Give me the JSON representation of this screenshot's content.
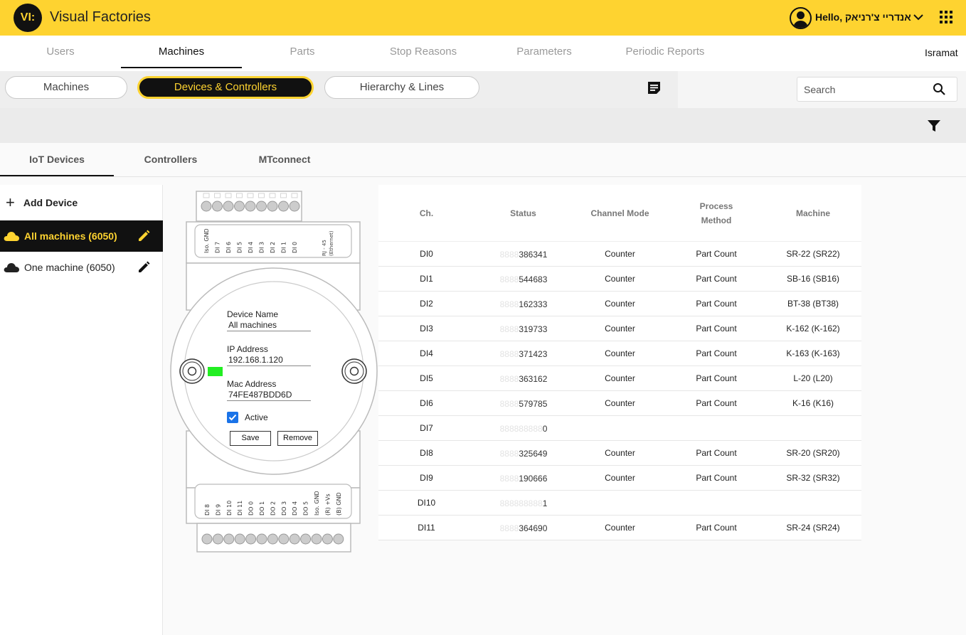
{
  "header": {
    "logo_text": "VI:",
    "brand": "Visual Factories",
    "greeting": "Hello, אנדריי צ'רניאק"
  },
  "main_nav": {
    "tabs": [
      {
        "label": "Users",
        "active": false
      },
      {
        "label": "Machines",
        "active": true
      },
      {
        "label": "Parts",
        "active": false
      },
      {
        "label": "Stop Reasons",
        "active": false
      },
      {
        "label": "Parameters",
        "active": false
      },
      {
        "label": "Periodic Reports",
        "active": false
      }
    ],
    "company": "Isramat"
  },
  "sub_nav": {
    "pills": [
      {
        "label": "Machines",
        "active": false
      },
      {
        "label": "Devices & Controllers",
        "active": true
      },
      {
        "label": "Hierarchy & Lines",
        "active": false
      }
    ],
    "search_placeholder": "Search"
  },
  "device_tabs": [
    {
      "label": "IoT Devices",
      "active": true
    },
    {
      "label": "Controllers",
      "active": false
    },
    {
      "label": "MTconnect",
      "active": false
    }
  ],
  "sidebar": {
    "add_label": "Add Device",
    "devices": [
      {
        "label": "All machines (6050)",
        "active": true
      },
      {
        "label": "One machine (6050)",
        "active": false
      }
    ]
  },
  "device": {
    "top_pins": [
      "Iso. GND",
      "DI 7",
      "DI 6",
      "DI 5",
      "DI 4",
      "DI 3",
      "DI 2",
      "DI 1",
      "DI 0"
    ],
    "ethernet_label": "RJ - 45",
    "ethernet_sub": "(Ethernet)",
    "bottom_pins": [
      "DI 8",
      "DI 9",
      "DI 10",
      "DI 11",
      "DO 0",
      "DO 1",
      "DO 2",
      "DO 3",
      "DO 4",
      "DO 5",
      "Iso. GND",
      "(R) +Vs",
      "(B) GND"
    ],
    "name_label": "Device Name",
    "name_value": "All machines",
    "ip_label": "IP Address",
    "ip_value": "192.168.1.120",
    "mac_label": "Mac Address",
    "mac_value": "74FE487BDD6D",
    "active_label": "Active",
    "active_checked": true,
    "save_label": "Save",
    "remove_label": "Remove",
    "status_color": "#22ee22"
  },
  "table": {
    "headers": {
      "ch": "Ch.",
      "status": "Status",
      "mode": "Channel Mode",
      "process_1": "Process",
      "process_2": "Method",
      "machine": "Machine"
    },
    "rows": [
      {
        "ch": "DI0",
        "ghost": "8888",
        "val": "386341",
        "mode": "Counter",
        "method": "Part Count",
        "machine": "SR-22 (SR22)"
      },
      {
        "ch": "DI1",
        "ghost": "8888",
        "val": "544683",
        "mode": "Counter",
        "method": "Part Count",
        "machine": "SB-16 (SB16)"
      },
      {
        "ch": "DI2",
        "ghost": "8888",
        "val": "162333",
        "mode": "Counter",
        "method": "Part Count",
        "machine": "BT-38 (BT38)"
      },
      {
        "ch": "DI3",
        "ghost": "8888",
        "val": "319733",
        "mode": "Counter",
        "method": "Part Count",
        "machine": "K-162 (K-162)"
      },
      {
        "ch": "DI4",
        "ghost": "8888",
        "val": "371423",
        "mode": "Counter",
        "method": "Part Count",
        "machine": "K-163 (K-163)"
      },
      {
        "ch": "DI5",
        "ghost": "8888",
        "val": "363162",
        "mode": "Counter",
        "method": "Part Count",
        "machine": "L-20 (L20)"
      },
      {
        "ch": "DI6",
        "ghost": "8888",
        "val": "579785",
        "mode": "Counter",
        "method": "Part Count",
        "machine": "K-16 (K16)"
      },
      {
        "ch": "DI7",
        "ghost": "888888888",
        "val": "0",
        "mode": "",
        "method": "",
        "machine": ""
      },
      {
        "ch": "DI8",
        "ghost": "8888",
        "val": "325649",
        "mode": "Counter",
        "method": "Part Count",
        "machine": "SR-20 (SR20)"
      },
      {
        "ch": "DI9",
        "ghost": "8888",
        "val": "190666",
        "mode": "Counter",
        "method": "Part Count",
        "machine": "SR-32 (SR32)"
      },
      {
        "ch": "DI10",
        "ghost": "888888888",
        "val": "1",
        "mode": "",
        "method": "",
        "machine": ""
      },
      {
        "ch": "DI11",
        "ghost": "8888",
        "val": "364690",
        "mode": "Counter",
        "method": "Part Count",
        "machine": "SR-24 (SR24)"
      }
    ]
  },
  "colors": {
    "brand_yellow": "#fed330",
    "active_dark": "#111111",
    "checkbox_blue": "#1a73e8"
  }
}
